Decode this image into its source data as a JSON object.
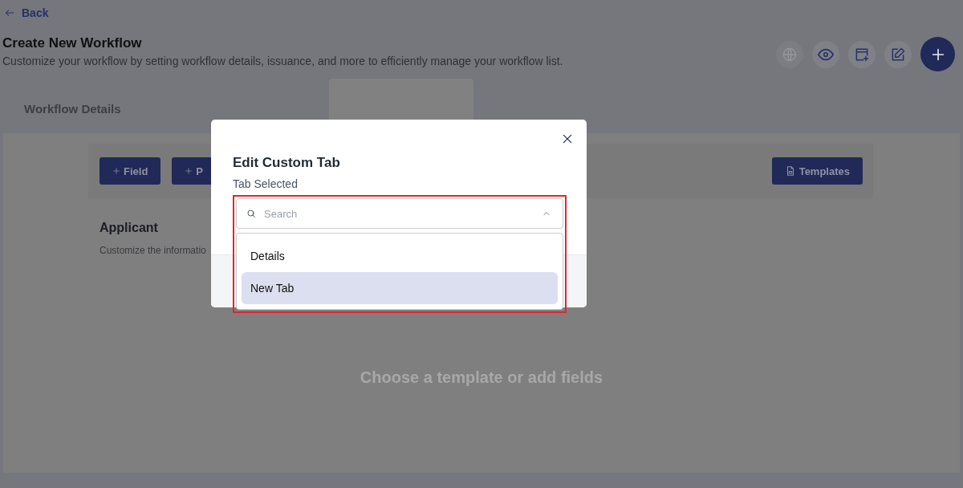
{
  "back_link": {
    "label": "Back"
  },
  "header": {
    "title": "Create New Workflow",
    "subtitle": "Customize your workflow by setting workflow details, issuance, and more to efficiently manage your workflow list."
  },
  "actions": [
    {
      "kind": "globe",
      "disabled": true
    },
    {
      "kind": "eye",
      "disabled": false
    },
    {
      "kind": "window-add",
      "disabled": false
    },
    {
      "kind": "edit",
      "disabled": false
    },
    {
      "kind": "add",
      "disabled": false
    }
  ],
  "tabs": [
    {
      "label": "Workflow Details",
      "selected": false
    }
  ],
  "toolbar": {
    "buttons": [
      {
        "label": "Field"
      },
      {
        "label": "P"
      }
    ],
    "templates_button": {
      "label": "Templates"
    }
  },
  "section": {
    "title": "Applicant",
    "description": "Customize the informatio"
  },
  "empty_state": "Choose a template or add fields",
  "modal": {
    "title": "Edit Custom Tab",
    "field_label": "Tab Selected",
    "search": {
      "placeholder": "Search"
    },
    "expanded": true,
    "options": [
      {
        "label": "Details",
        "selected": false
      },
      {
        "label": "New Tab",
        "selected": true
      }
    ]
  }
}
